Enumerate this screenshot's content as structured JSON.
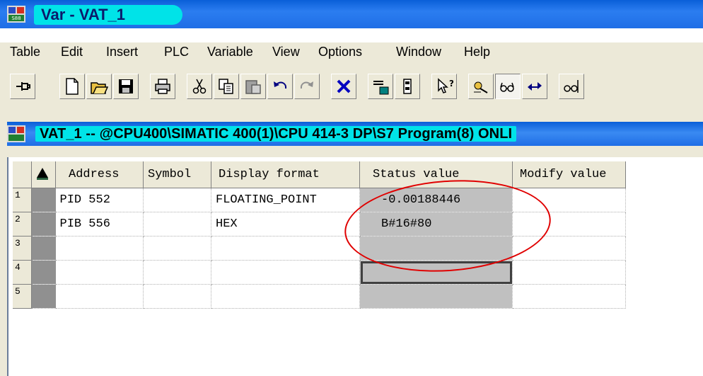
{
  "window": {
    "title": "Var - VAT_1"
  },
  "menu": [
    "Table",
    "Edit",
    "Insert",
    "PLC",
    "Variable",
    "View",
    "Options",
    "Window",
    "Help"
  ],
  "toolbar": {
    "icons": [
      "pin-icon",
      "new-icon",
      "open-icon",
      "save-icon",
      "print-icon",
      "cut-icon",
      "copy-icon",
      "paste-icon",
      "undo-icon",
      "redo-icon",
      "delete-icon",
      "monitor-icon",
      "module-icon",
      "help-pointer-icon",
      "monitor-variable-icon",
      "glasses-icon",
      "modify-icon",
      "glasses-trigger-icon"
    ]
  },
  "child": {
    "title": "VAT_1 -- @CPU400\\SIMATIC 400(1)\\CPU 414-3 DP\\S7 Program(8)  ONLI"
  },
  "table": {
    "headers": [
      "Address",
      "Symbol",
      "Display format",
      "Status value",
      "Modify value"
    ],
    "rows": [
      {
        "num": "1",
        "address": "PID  552",
        "symbol": "",
        "format": "FLOATING_POINT",
        "status": "-0.00188446",
        "modify": ""
      },
      {
        "num": "2",
        "address": "PIB  556",
        "symbol": "",
        "format": "HEX",
        "status": "B#16#80",
        "modify": ""
      },
      {
        "num": "3",
        "address": "",
        "symbol": "",
        "format": "",
        "status": "",
        "modify": ""
      },
      {
        "num": "4",
        "address": "",
        "symbol": "",
        "format": "",
        "status": "",
        "modify": ""
      },
      {
        "num": "5",
        "address": "",
        "symbol": "",
        "format": "",
        "status": "",
        "modify": ""
      }
    ]
  },
  "colors": {
    "title_blue": "#0a5fd8",
    "title_highlight": "#00e3e8",
    "annotation_red": "#e00000"
  }
}
